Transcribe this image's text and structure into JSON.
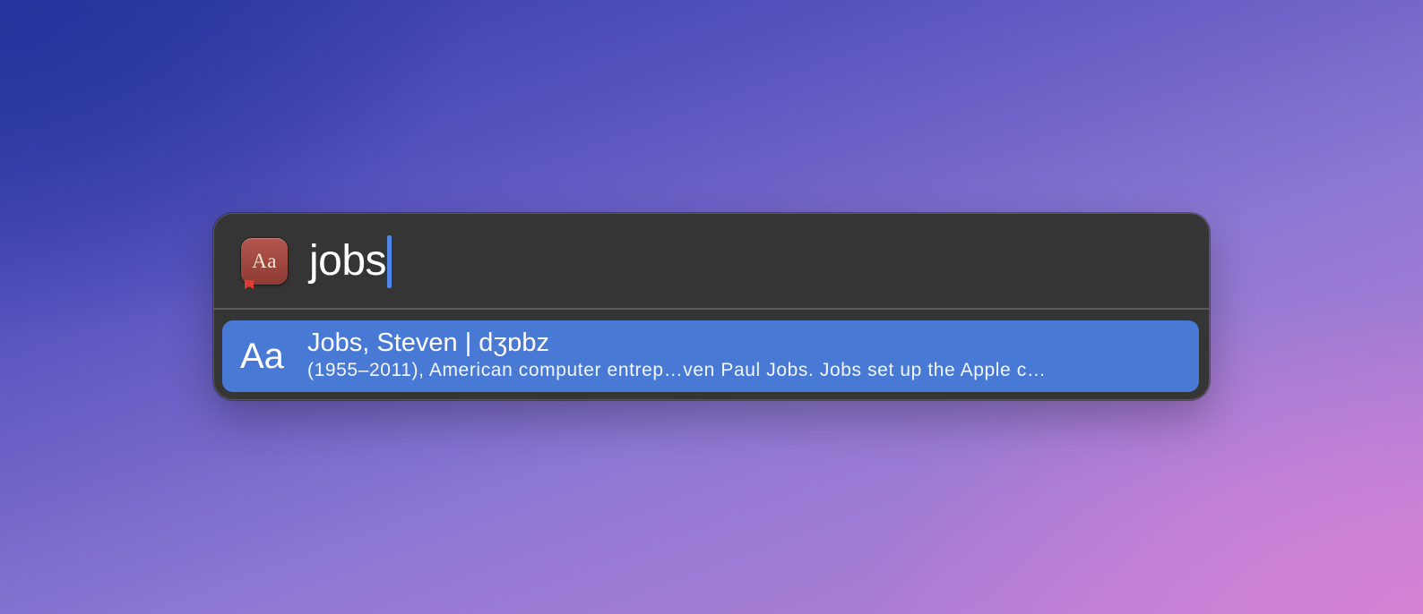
{
  "spotlight": {
    "app_icon": {
      "name": "dictionary-icon",
      "label": "Aa"
    },
    "query": "jobs",
    "results": [
      {
        "icon_label": "Aa",
        "title": "Jobs, Steven | dʒɒbz",
        "subtitle": "(1955–2011), American computer entrep…ven Paul Jobs. Jobs set up the Apple c…",
        "selected": true
      }
    ]
  },
  "colors": {
    "panel": "#353535",
    "selection": "#4779d5",
    "caret": "#4d86e6",
    "dictionary_icon": "#9f4840"
  }
}
